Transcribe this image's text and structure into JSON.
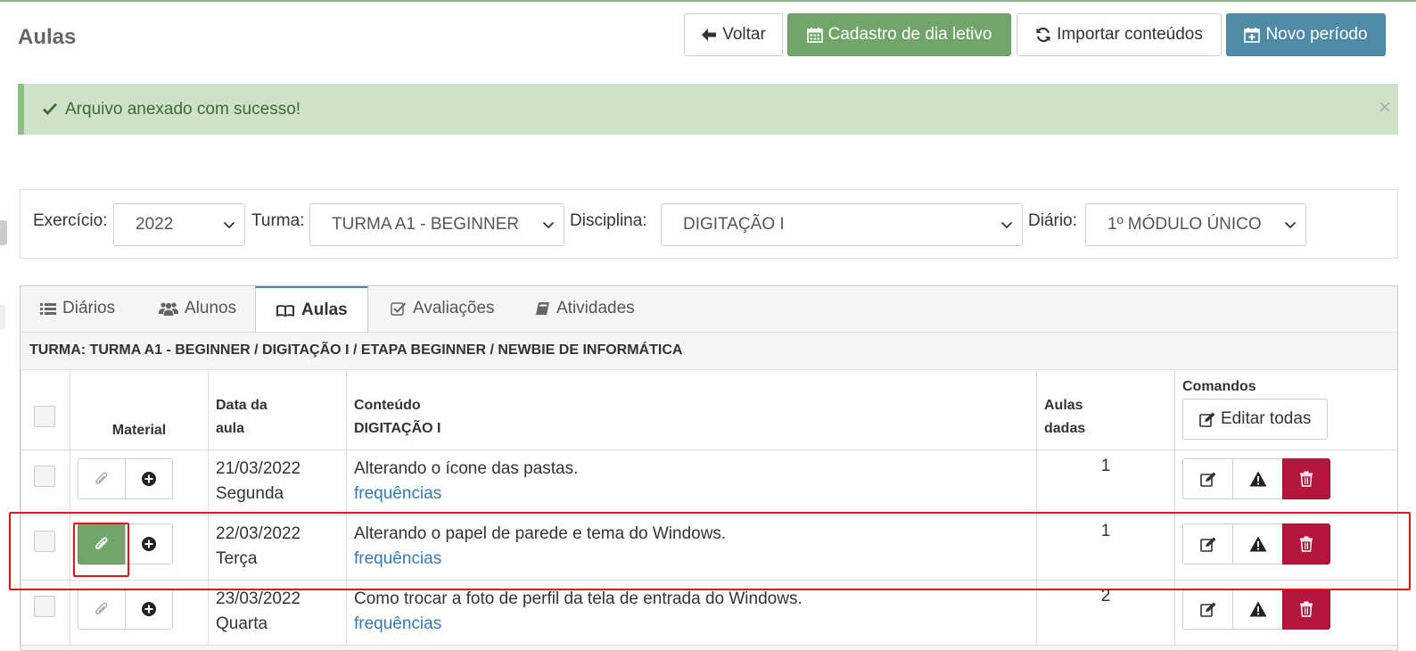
{
  "page": {
    "title": "Aulas"
  },
  "toolbar": {
    "back_label": "Voltar",
    "calendar_label": "Cadastro de dia letivo",
    "import_label": "Importar conteúdos",
    "new_period_label": "Novo período"
  },
  "alert": {
    "message": "Arquivo anexado com sucesso!",
    "close": "×"
  },
  "filters": {
    "exercicio": {
      "label": "Exercício:",
      "value": "2022"
    },
    "turma": {
      "label": "Turma:",
      "value": "TURMA A1 - BEGINNER"
    },
    "disciplina": {
      "label": "Disciplina:",
      "value": "DIGITAÇÃO I"
    },
    "diario": {
      "label": "Diário:",
      "value": "1º MÓDULO ÚNICO"
    }
  },
  "tabs": [
    {
      "label": "Diários",
      "icon": "list-icon"
    },
    {
      "label": "Alunos",
      "icon": "users-icon"
    },
    {
      "label": "Aulas",
      "icon": "book-icon"
    },
    {
      "label": "Avaliações",
      "icon": "check-square-icon"
    },
    {
      "label": "Atividades",
      "icon": "notebook-icon"
    }
  ],
  "breadcrumb": "TURMA: TURMA A1 - BEGINNER / DIGITAÇÃO I / ETAPA BEGINNER / NEWBIE DE INFORMÁTICA",
  "table": {
    "headers": {
      "material": "Material",
      "date_line1": "Data da",
      "date_line2": "aula",
      "content_line1": "Conteúdo",
      "content_line2": "DIGITAÇÃO I",
      "count_line1": "Aulas",
      "count_line2": "dadas",
      "commands": "Comandos",
      "edit_all": "Editar todas"
    },
    "rows": [
      {
        "date": "21/03/2022",
        "weekday": "Segunda",
        "content": "Alterando o ícone das pastas.",
        "link": "frequências",
        "count": "1"
      },
      {
        "date": "22/03/2022",
        "weekday": "Terça",
        "content": "Alterando o papel de parede e tema do Windows.",
        "link": "frequências",
        "count": "1"
      },
      {
        "date": "23/03/2022",
        "weekday": "Quarta",
        "content": "Como trocar a foto de perfil da tela de entrada do Windows.",
        "link": "frequências",
        "count": "2"
      }
    ]
  },
  "colors": {
    "success": "#72a56b",
    "primary": "#4f8aa6",
    "danger": "#b3163a",
    "link": "#337ab7",
    "highlight": "#e01818"
  }
}
